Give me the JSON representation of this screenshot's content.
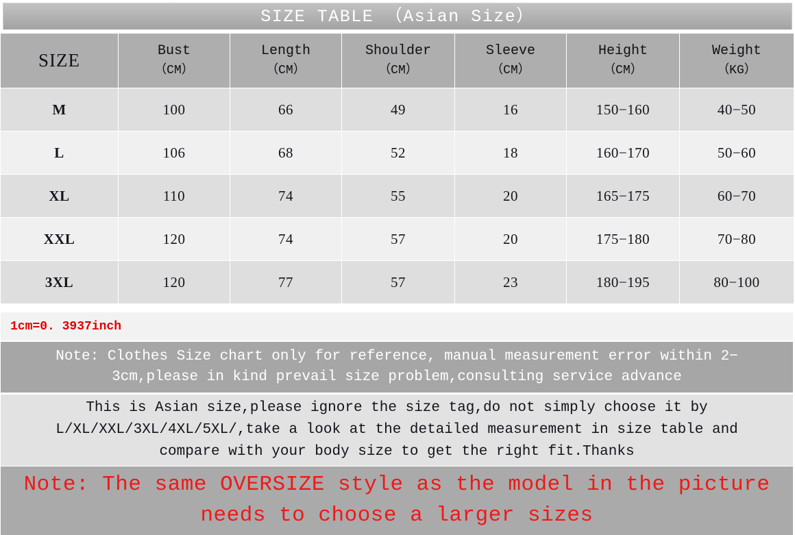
{
  "title": {
    "text": "SIZE TABLE （Asian Size）"
  },
  "table": {
    "columns": [
      {
        "label": "SIZE",
        "unit": ""
      },
      {
        "label": "Bust",
        "unit": "（CM）"
      },
      {
        "label": "Length",
        "unit": "（CM）"
      },
      {
        "label": "Shoulder",
        "unit": "（CM）"
      },
      {
        "label": "Sleeve",
        "unit": "（CM）"
      },
      {
        "label": "Height",
        "unit": "（CM）"
      },
      {
        "label": "Weight",
        "unit": "（KG）"
      }
    ],
    "rows": [
      {
        "size": "M",
        "bust": "100",
        "length": "66",
        "shoulder": "49",
        "sleeve": "16",
        "height": "150−160",
        "weight": "40−50"
      },
      {
        "size": "L",
        "bust": "106",
        "length": "68",
        "shoulder": "52",
        "sleeve": "18",
        "height": "160−170",
        "weight": "50−60"
      },
      {
        "size": "XL",
        "bust": "110",
        "length": "74",
        "shoulder": "55",
        "sleeve": "20",
        "height": "165−175",
        "weight": "60−70"
      },
      {
        "size": "XXL",
        "bust": "120",
        "length": "74",
        "shoulder": "57",
        "sleeve": "20",
        "height": "175−180",
        "weight": "70−80"
      },
      {
        "size": "3XL",
        "bust": "120",
        "length": "77",
        "shoulder": "57",
        "sleeve": "23",
        "height": "180−195",
        "weight": "80−100"
      }
    ]
  },
  "conversion": {
    "text": "1cm=0. 3937inch"
  },
  "note_band": {
    "line1": "Note: Clothes Size chart only for reference, manual measurement error within 2−",
    "line2": "3cm,please in kind prevail size problem,consulting service advance"
  },
  "asian_note": {
    "line1": "This is Asian size,please ignore the size tag,do not simply choose it by",
    "line2": "L/XL/XXL/3XL/4XL/5XL/,take a look at the detailed measurement in size table and",
    "line3": "compare with your body size to get the right fit.Thanks"
  },
  "oversize_note": {
    "line1": "Note: The same OVERSIZE style as the model in the picture",
    "line2": "needs to choose a larger sizes"
  },
  "colors": {
    "title_bar": "#b4b4b4",
    "header_row": "#aeaeae",
    "row_dark": "#dedede",
    "row_light": "#f0f0f0",
    "note_band": "#a6a6a6",
    "asian_band": "#e2e2e2",
    "red_band": "#aaaaaa",
    "red_text": "#f01818",
    "conversion_text": "#e00000"
  }
}
